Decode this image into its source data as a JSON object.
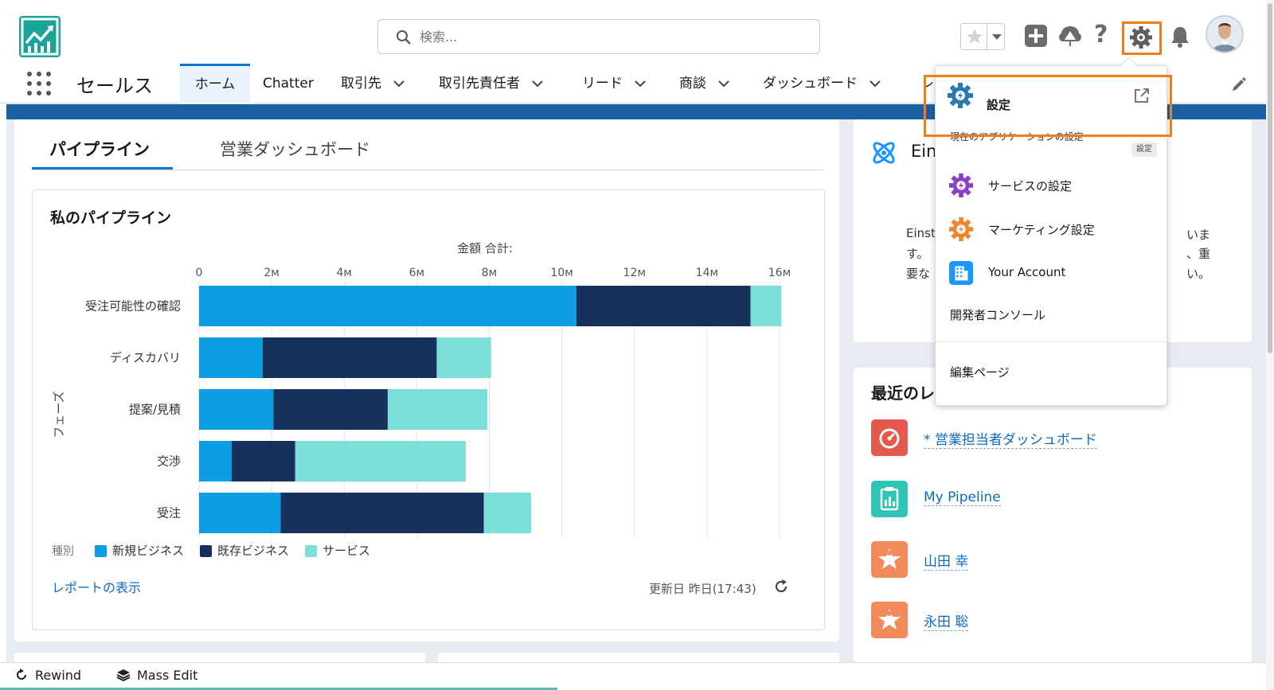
{
  "header": {
    "search_placeholder": "検索..."
  },
  "nav": {
    "app_name": "セールス",
    "tabs": [
      {
        "label": "ホーム"
      },
      {
        "label": "Chatter"
      },
      {
        "label": "取引先"
      },
      {
        "label": "取引先責任者"
      },
      {
        "label": "リード"
      },
      {
        "label": "商談"
      },
      {
        "label": "ダッシュボード"
      },
      {
        "label": "レ"
      }
    ]
  },
  "main_card": {
    "tabs": [
      "パイプライン",
      "営業ダッシュボード"
    ],
    "chart_title": "私のパイプライン",
    "view_report": "レポートの表示",
    "updated": "更新日 昨日(17:43)"
  },
  "chart_data": {
    "type": "bar",
    "orientation": "horizontal",
    "stacked": true,
    "title": "私のパイプライン",
    "xlabel": "金額 合計:",
    "ylabel": "フェーズ",
    "xlim": [
      0,
      16
    ],
    "x_ticks": [
      "0",
      "2м",
      "4м",
      "6м",
      "8м",
      "10м",
      "12м",
      "14м",
      "16м"
    ],
    "categories": [
      "受注可能性の確認",
      "ディスカバリ",
      "提案/見積",
      "交渉",
      "受注"
    ],
    "legend_title": "種別",
    "legend_position": "bottom",
    "grid": true,
    "series": [
      {
        "name": "新規ビジネス",
        "color": "#0b9ee3",
        "values": [
          10.4,
          1.75,
          2.05,
          0.9,
          2.25
        ]
      },
      {
        "name": "既存ビジネス",
        "color": "#16325c",
        "values": [
          4.8,
          4.8,
          3.15,
          1.75,
          5.6
        ]
      },
      {
        "name": "サービス",
        "color": "#7cded8",
        "values": [
          0.85,
          1.5,
          2.75,
          4.7,
          1.3
        ]
      }
    ]
  },
  "einstein": {
    "title": "Ein",
    "lines": [
      {
        "left": "Einst",
        "right": "いま"
      },
      {
        "left": "す。",
        "right": "、重"
      },
      {
        "left": "要な",
        "right": "い。"
      }
    ]
  },
  "recent": {
    "title": "最近のレ",
    "items": [
      {
        "label": "* 営業担当者ダッシュボード",
        "icon": "dashboard-icon",
        "color": "#e4594d"
      },
      {
        "label": "My Pipeline",
        "icon": "report-icon",
        "color": "#2ec4b6"
      },
      {
        "label": "山田 幸",
        "icon": "lead-icon",
        "color": "#f38a5a"
      },
      {
        "label": "永田 聡",
        "icon": "lead-icon",
        "color": "#f38a5a"
      }
    ]
  },
  "setup_menu": {
    "setup_label": "設定",
    "setup_sub": "現在のアプリケーションの設定",
    "tooltip": "設定",
    "items": [
      {
        "label": "サービスの設定",
        "icon": "service-setup-icon",
        "color": "#8a3fc9"
      },
      {
        "label": "マーケティング設定",
        "icon": "marketing-setup-icon",
        "color": "#f0862e"
      },
      {
        "label": "Your Account",
        "icon": "account-icon",
        "color": "#1b96ff"
      },
      {
        "label": "開発者コンソール",
        "icon": "",
        "color": ""
      },
      {
        "label": "編集ページ",
        "icon": "",
        "color": ""
      }
    ]
  },
  "utility_bar": {
    "items": [
      "Rewind",
      "Mass Edit"
    ]
  },
  "colors": {
    "brand_blue": "#0176d3",
    "highlight_orange": "#ef7d1a",
    "logo_teal": "#1aa39a"
  }
}
